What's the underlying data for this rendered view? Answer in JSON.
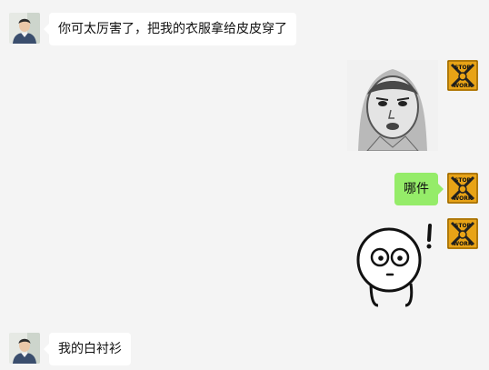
{
  "messages": [
    {
      "id": "m1",
      "side": "left",
      "type": "text",
      "text": "你可太厉害了，把我的衣服拿给皮皮穿了"
    },
    {
      "id": "m2",
      "side": "right",
      "type": "sticker",
      "sticker": "meme-face-sticker"
    },
    {
      "id": "m3",
      "side": "right",
      "type": "text",
      "text": "哪件"
    },
    {
      "id": "m4",
      "side": "right",
      "type": "sticker",
      "sticker": "confused-cartoon-sticker"
    },
    {
      "id": "m5",
      "side": "left",
      "type": "text",
      "text": "我的白衬衫"
    }
  ],
  "avatars": {
    "left": {
      "icon": "person-photo-avatar"
    },
    "right": {
      "icon": "stop-work-badge-avatar",
      "text_lines": [
        "STOP",
        "WORK"
      ],
      "color": "#e8a316"
    }
  },
  "colors": {
    "background": "#f4f4f4",
    "bubble_left": "#ffffff",
    "bubble_right": "#95ec69"
  }
}
